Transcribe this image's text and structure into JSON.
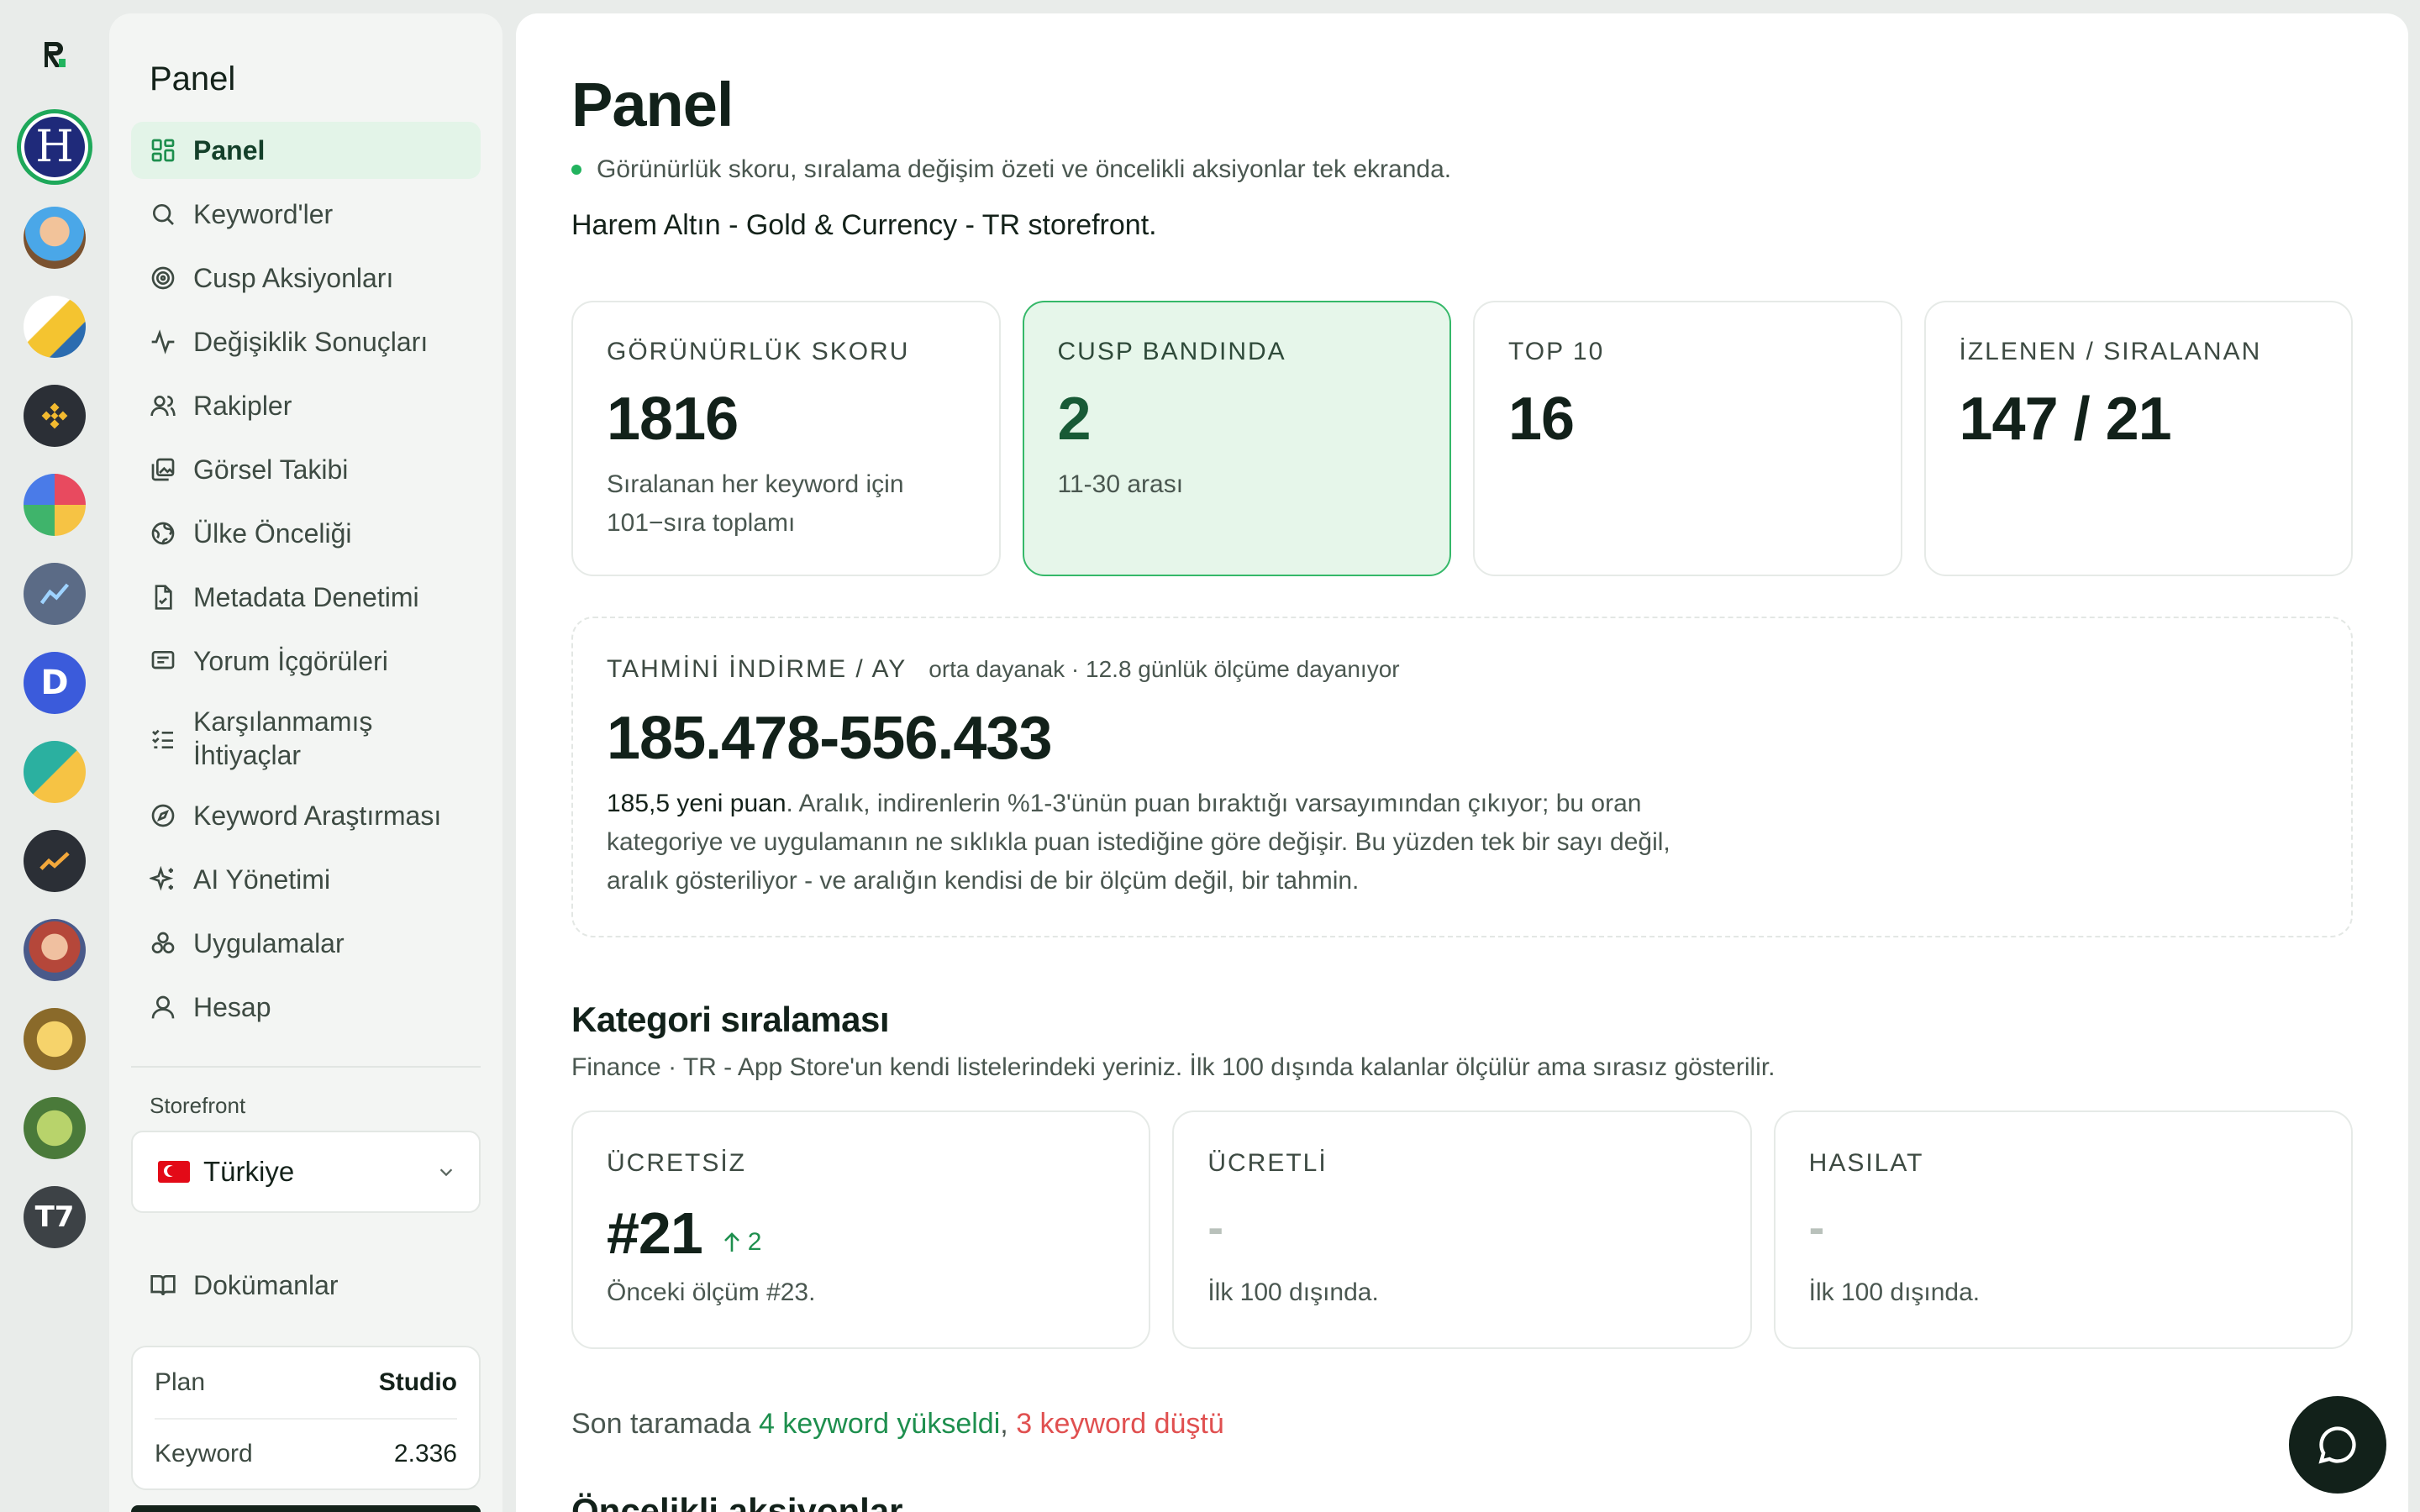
{
  "sidebar": {
    "title": "Panel",
    "nav": [
      {
        "label": "Panel",
        "icon": "grid-icon",
        "active": true
      },
      {
        "label": "Keyword'ler",
        "icon": "search-icon"
      },
      {
        "label": "Cusp Aksiyonları",
        "icon": "target-icon"
      },
      {
        "label": "Değişiklik Sonuçları",
        "icon": "activity-icon"
      },
      {
        "label": "Rakipler",
        "icon": "users-icon"
      },
      {
        "label": "Görsel Takibi",
        "icon": "images-icon"
      },
      {
        "label": "Ülke Önceliği",
        "icon": "globe-icon"
      },
      {
        "label": "Metadata Denetimi",
        "icon": "file-check-icon"
      },
      {
        "label": "Yorum İçgörüleri",
        "icon": "message-icon"
      },
      {
        "label": "Karşılanmamış İhtiyaçlar",
        "icon": "list-check-icon"
      },
      {
        "label": "Keyword Araştırması",
        "icon": "compass-icon"
      },
      {
        "label": "AI Yönetimi",
        "icon": "sparkles-icon"
      },
      {
        "label": "Uygulamalar",
        "icon": "apps-icon"
      },
      {
        "label": "Hesap",
        "icon": "user-icon"
      }
    ],
    "storefront_label": "Storefront",
    "storefront_value": "Türkiye",
    "docs_label": "Dokümanlar",
    "plan_label": "Plan",
    "plan_value": "Studio",
    "keyword_label": "Keyword",
    "keyword_value": "2.336"
  },
  "rail": {
    "active_app_letter": "H"
  },
  "main": {
    "title": "Panel",
    "subtitle": "Görünürlük skoru, sıralama değişim özeti ve öncelikli aksiyonlar tek ekranda.",
    "app_name": "Harem Altın - Gold & Currency - TR storefront.",
    "stats": [
      {
        "key": "GÖRÜNÜRLÜK SKORU",
        "value": "1816",
        "desc": "Sıralanan her keyword için 101−sıra toplamı"
      },
      {
        "key": "CUSP BANDINDA",
        "value": "2",
        "desc": "11-30 arası"
      },
      {
        "key": "TOP 10",
        "value": "16",
        "desc": ""
      },
      {
        "key": "İZLENEN / SIRALANAN",
        "value": "147 / 21",
        "desc": ""
      }
    ],
    "downloads": {
      "key": "TAHMİNİ İNDİRME / AY",
      "note": "orta dayanak · 12.8 günlük ölçüme dayanıyor",
      "value": "185.478-556.433",
      "desc_strong": "185,5 yeni puan",
      "desc": ". Aralık, indirenlerin %1-3'ünün puan bıraktığı varsayımından çıkıyor; bu oran kategoriye ve uygulamanın ne sıklıkla puan istediğine göre değişir. Bu yüzden tek bir sayı değil, aralık gösteriliyor - ve aralığın kendisi de bir ölçüm değil, bir tahmin."
    },
    "category": {
      "title": "Kategori sıralaması",
      "subtitle": "Finance · TR - App Store'un kendi listelerindeki yeriniz. İlk 100 dışında kalanlar ölçülür ama sırasız gösterilir.",
      "cards": [
        {
          "key": "ÜCRETSİZ",
          "value": "#21",
          "delta": "2",
          "desc": "Önceki ölçüm #23."
        },
        {
          "key": "ÜCRETLİ",
          "value": "-",
          "desc": "İlk 100 dışında."
        },
        {
          "key": "HASILAT",
          "value": "-",
          "desc": "İlk 100 dışında."
        }
      ]
    },
    "summary": {
      "prefix": "Son taramada ",
      "up": "4 keyword yükseldi",
      "sep": ", ",
      "down": "3 keyword düştü"
    },
    "next_section_title": "Öncelikli aksiyonlar"
  },
  "colors": {
    "accent_green": "#22b35e",
    "highlight_bg": "#e6f6ea",
    "down_red": "#e05050",
    "dark": "#12211a"
  }
}
